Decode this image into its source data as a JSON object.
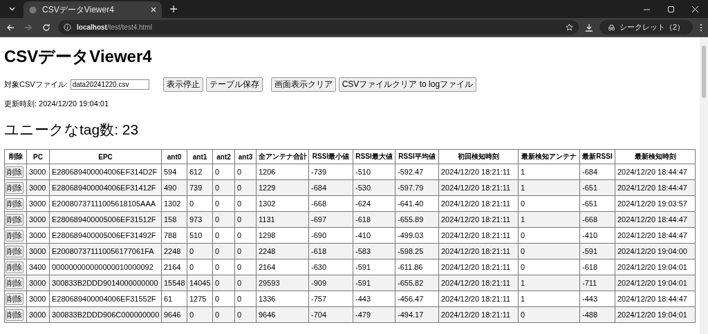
{
  "browser": {
    "tab_title": "CSVデータViewer4",
    "url_host": "localhost",
    "url_path": "/test/test4.html",
    "profile": "シークレット（2）"
  },
  "page": {
    "title": "CSVデータViewer4",
    "file_label": "対象CSVファイル:",
    "file_value": "data20241220.csv",
    "button_groups": [
      [
        "表示停止",
        "テーブル保存"
      ],
      [
        "画面表示クリア",
        "CSVファイルクリア to logファイル"
      ]
    ],
    "updated": "更新時刻: 2024/12/20 19:04:01",
    "unique_count": "ユニークなtag数: 23"
  },
  "table": {
    "columns": [
      "削除",
      "PC",
      "EPC",
      "ant0",
      "ant1",
      "ant2",
      "ant3",
      "全アンテナ合計",
      "RSSI最小値",
      "RSSI最大値",
      "RSSI平均値",
      "初回検知時刻",
      "最新検知アンテナ",
      "最新RSSI",
      "最新検知時刻"
    ],
    "rows": [
      {
        "cells": [
          "削除",
          "3000",
          "E280689400004006EF314D2F",
          "594",
          "612",
          "0",
          "0",
          "1206",
          "-739",
          "-510",
          "-592.47",
          "2024/12/20 18:21:11",
          "1",
          "-684",
          "2024/12/20 18:44:47"
        ]
      },
      {
        "cells": [
          "削除",
          "3000",
          "E280689400004006EF31412F",
          "490",
          "739",
          "0",
          "0",
          "1229",
          "-684",
          "-530",
          "-597.79",
          "2024/12/20 18:21:11",
          "1",
          "-651",
          "2024/12/20 18:44:47"
        ]
      },
      {
        "cells": [
          "削除",
          "3000",
          "E20080737111005618105AAA",
          "1302",
          "0",
          "0",
          "0",
          "1302",
          "-668",
          "-624",
          "-641.40",
          "2024/12/20 18:21:11",
          "0",
          "-651",
          "2024/12/20 19:03:57"
        ]
      },
      {
        "cells": [
          "削除",
          "3000",
          "E280689400005006EF31512F",
          "158",
          "973",
          "0",
          "0",
          "1131",
          "-697",
          "-618",
          "-655.89",
          "2024/12/20 18:21:11",
          "1",
          "-668",
          "2024/12/20 18:44:47"
        ]
      },
      {
        "cells": [
          "削除",
          "3000",
          "E280689400005006EF31492F",
          "788",
          "510",
          "0",
          "0",
          "1298",
          "-690",
          "-410",
          "-499.03",
          "2024/12/20 18:21:11",
          "0",
          "-410",
          "2024/12/20 18:44:47"
        ]
      },
      {
        "cells": [
          "削除",
          "3000",
          "E200807371110056177061FA",
          "2248",
          "0",
          "0",
          "0",
          "2248",
          "-618",
          "-583",
          "-598.25",
          "2024/12/20 18:21:11",
          "0",
          "-591",
          "2024/12/20 19:04:00"
        ]
      },
      {
        "cells": [
          "削除",
          "3400",
          "000000000000000010000092",
          "2164",
          "0",
          "0",
          "0",
          "2164",
          "-630",
          "-591",
          "-611.86",
          "2024/12/20 18:21:11",
          "0",
          "-618",
          "2024/12/20 19:04:01"
        ]
      },
      {
        "cells": [
          "削除",
          "3000",
          "300833B2DDD9014000000000",
          "15548",
          "14045",
          "0",
          "0",
          "29593",
          "-909",
          "-591",
          "-655.82",
          "2024/12/20 18:21:11",
          "1",
          "-711",
          "2024/12/20 19:04:01"
        ]
      },
      {
        "cells": [
          "削除",
          "3000",
          "E280689400004006EF31552F",
          "61",
          "1275",
          "0",
          "0",
          "1336",
          "-757",
          "-443",
          "-456.47",
          "2024/12/20 18:21:11",
          "1",
          "-443",
          "2024/12/20 18:44:47"
        ]
      },
      {
        "cells": [
          "削除",
          "3000",
          "300833B2DDD906C000000000",
          "9646",
          "0",
          "0",
          "0",
          "9646",
          "-704",
          "-479",
          "-494.17",
          "2024/12/20 18:21:11",
          "0",
          "-488",
          "2024/12/20 19:04:01"
        ]
      }
    ]
  }
}
